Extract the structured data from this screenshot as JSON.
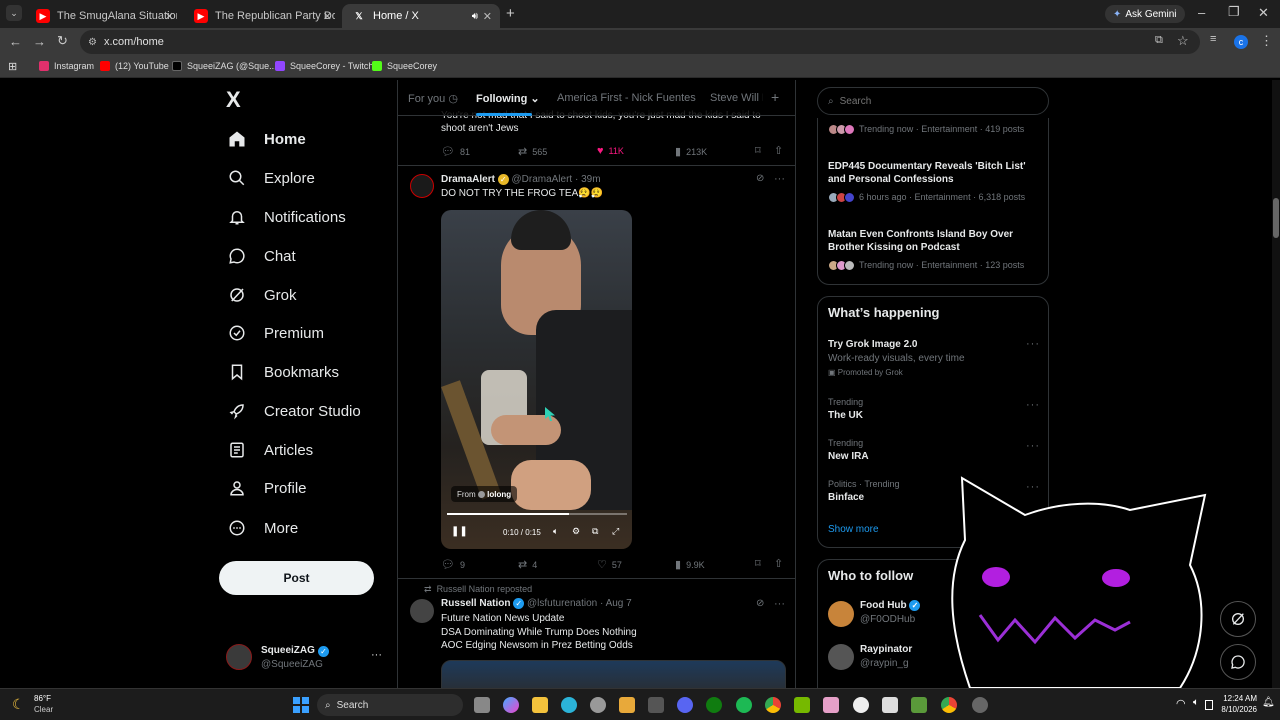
{
  "browser": {
    "tabs": [
      {
        "title": "The SmugAlana Situation Just G",
        "color": "#ff0000"
      },
      {
        "title": "The Republican Party Does Not",
        "color": "#ff0000"
      },
      {
        "title": "Home / X",
        "color": "#000000"
      }
    ],
    "new_tab": "+",
    "ask_gemini": "Ask Gemini",
    "url": "x.com/home",
    "profile_initial": "c",
    "bookmarks": [
      {
        "label": "Instagram",
        "color": "#e1306c"
      },
      {
        "label": "(12) YouTube",
        "color": "#ff0000"
      },
      {
        "label": "SqueeiZAG (@Sque...",
        "color": "#000000"
      },
      {
        "label": "SqueeCorey - Twitch",
        "color": "#9146ff"
      },
      {
        "label": "SqueeCorey",
        "color": "#53fc18"
      }
    ]
  },
  "sidebar": {
    "logo": "X",
    "items": [
      {
        "label": "Home",
        "icon": "home-icon"
      },
      {
        "label": "Explore",
        "icon": "search-icon"
      },
      {
        "label": "Notifications",
        "icon": "bell-icon"
      },
      {
        "label": "Chat",
        "icon": "chat-icon"
      },
      {
        "label": "Grok",
        "icon": "grok-icon"
      },
      {
        "label": "Premium",
        "icon": "premium-icon"
      },
      {
        "label": "Bookmarks",
        "icon": "bookmark-icon"
      },
      {
        "label": "Creator Studio",
        "icon": "rocket-icon"
      },
      {
        "label": "Articles",
        "icon": "article-icon"
      },
      {
        "label": "Profile",
        "icon": "person-icon"
      },
      {
        "label": "More",
        "icon": "more-icon"
      }
    ],
    "post_label": "Post",
    "account": {
      "name": "SqueeiZAG",
      "handle": "@SqueeiZAG"
    }
  },
  "timeline": {
    "tabs": [
      "For you",
      "Following",
      "America First - Nick Fuentes",
      "Steve Will D"
    ],
    "add_tab": "+",
    "prev_post": {
      "text_line1": "You're not mad that I said to shoot kids, you're just mad the kids I said to",
      "text_line2": "shoot aren't Jews",
      "replies": "81",
      "reposts": "565",
      "likes": "11K",
      "views": "213K"
    },
    "post1": {
      "name": "DramaAlert",
      "handle": "@DramaAlert",
      "time": "· 39m",
      "text": "DO NOT TRY THE FROG TEA😮‍💨😮‍💨",
      "video_from": "From",
      "video_source": "lolong",
      "video_time": "0:10 / 0:15",
      "replies": "9",
      "reposts": "4",
      "likes": "57",
      "views": "9.9K"
    },
    "post2": {
      "repost_label": "Russell Nation reposted",
      "name": "Russell Nation",
      "handle": "@lsfuturenation",
      "time": "· Aug 7",
      "line1": "Future Nation News Update",
      "line2": "DSA Dominating While Trump Does Nothing",
      "line3": "AOC Edging Newsom in Prez Betting Odds"
    }
  },
  "right": {
    "search_placeholder": "Search",
    "trends_top": [
      {
        "title": "",
        "meta": "Trending now · Entertainment · 419 posts"
      },
      {
        "title_l1": "EDP445 Documentary Reveals 'Bitch List'",
        "title_l2": "and Personal Confessions",
        "meta": "6 hours ago · Entertainment · 6,318 posts"
      },
      {
        "title_l1": "Matan Even Confronts Island Boy Over",
        "title_l2": "Brother Kissing on Podcast",
        "meta": "Trending now · Entertainment · 123 posts"
      }
    ],
    "whats_happening": {
      "heading": "What’s happening",
      "promo_title": "Try Grok Image 2.0",
      "promo_sub": "Work-ready visuals, every time",
      "promo_by": "Promoted by Grok",
      "items": [
        {
          "context": "Trending",
          "title": "The UK"
        },
        {
          "context": "Trending",
          "title": "New IRA"
        },
        {
          "context": "Politics · Trending",
          "title": "Binface"
        }
      ],
      "show_more": "Show more"
    },
    "who_to_follow": {
      "heading": "Who to follow",
      "accounts": [
        {
          "name": "Food Hub",
          "handle": "@F0ODHub"
        },
        {
          "name": "Raypinator",
          "handle": "@raypin_g"
        }
      ]
    }
  },
  "taskbar": {
    "weather_temp": "86°F",
    "weather_desc": "Clear",
    "search_label": "Search",
    "time": "12:24 AM",
    "date": "8/10/2026"
  }
}
